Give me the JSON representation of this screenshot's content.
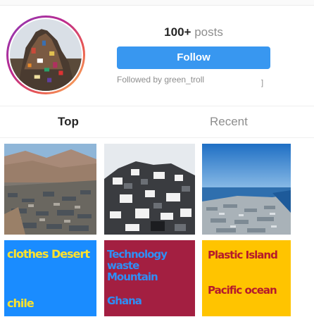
{
  "profile": {
    "post_count": "100+",
    "posts_label": "posts",
    "follow_label": "Follow",
    "followed_by": "Followed by green_troll",
    "followed_mark": "]"
  },
  "tabs": [
    {
      "label": "Top",
      "active": true
    },
    {
      "label": "Recent",
      "active": false
    }
  ],
  "grid": {
    "photos": [
      {
        "icon": "desert-clothes-photo"
      },
      {
        "icon": "ewaste-pile-photo"
      },
      {
        "icon": "plastic-coast-photo"
      }
    ],
    "captions": [
      {
        "bg": "#1a8cff",
        "line1": "clothes Desert",
        "line2": "chile"
      },
      {
        "bg": "#a31f41",
        "line1": "Technology",
        "line1b": "waste",
        "line1c": "Mountain",
        "line2": "Ghana"
      },
      {
        "bg": "#ffc400",
        "line1": "Plastic Island",
        "line2": "Pacific ocean"
      }
    ]
  },
  "colors": {
    "accent": "#3897f0",
    "text": "#262626",
    "muted": "#8e8e8e"
  }
}
